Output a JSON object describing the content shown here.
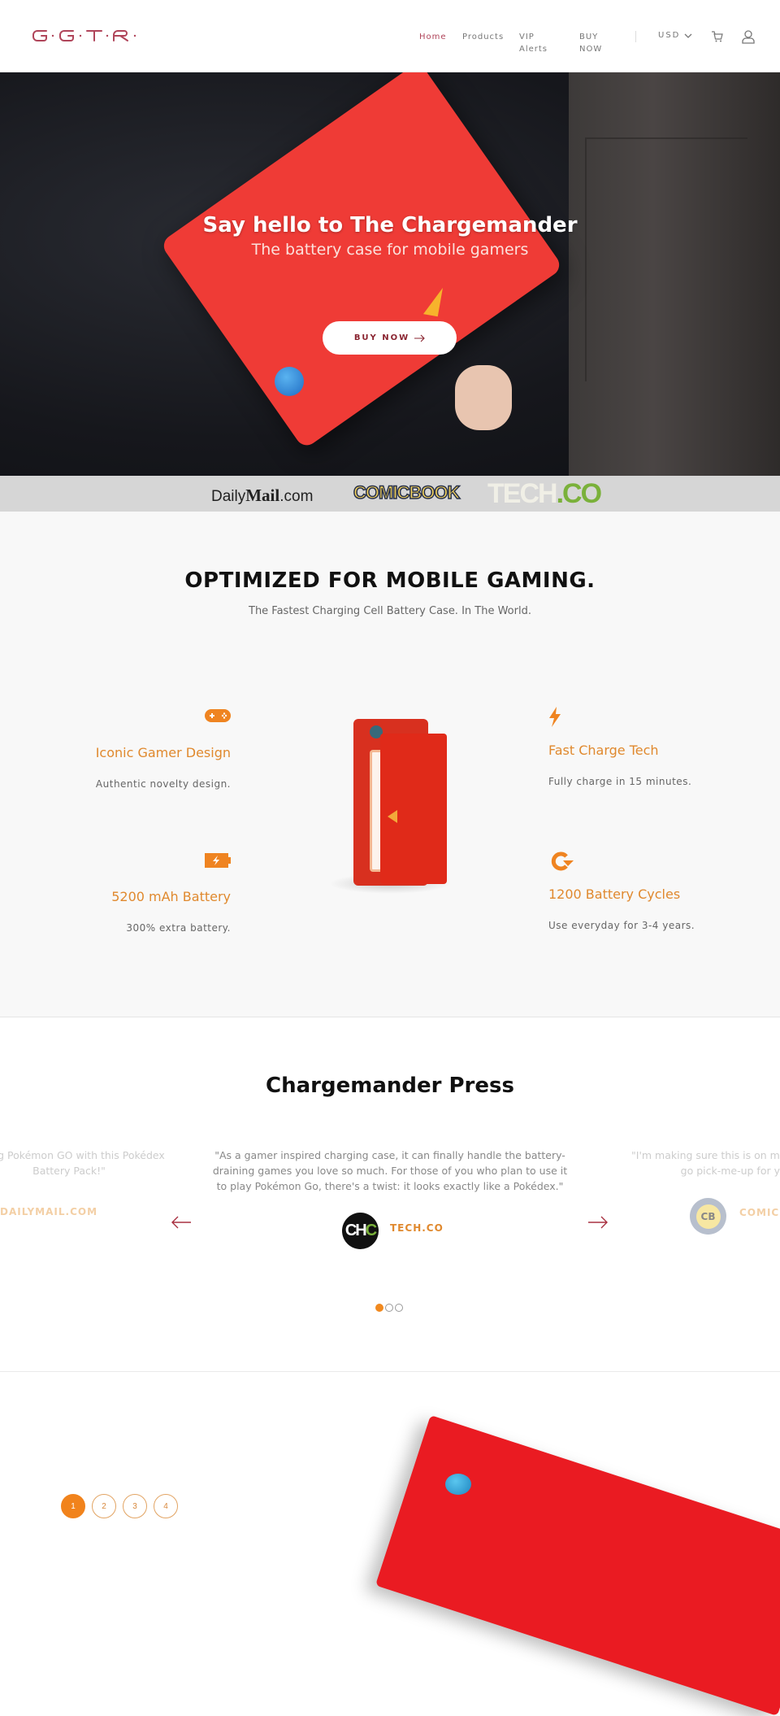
{
  "header": {
    "logo_text": "G·G·T·R·",
    "nav": [
      {
        "label": "Home",
        "active": true
      },
      {
        "label": "Products"
      },
      {
        "label": "VIP Alerts"
      },
      {
        "label": "BUY NOW"
      }
    ],
    "currency": "USD",
    "icons": {
      "currency_dropdown": "chevron-down-icon",
      "cart": "cart-icon",
      "account": "user-icon"
    },
    "brand_color": "#b0455a"
  },
  "hero": {
    "title": "Say hello to The Chargemander",
    "subtitle": "The battery case for mobile gamers",
    "button_label": "BUY NOW",
    "button_icon": "arrow-right-icon"
  },
  "press_logos": [
    {
      "name": "DailyMail.com",
      "part1": "Daily",
      "part2": "Mail",
      "part3": ".com"
    },
    {
      "name": "COMICBOOK.com",
      "text": "COMICBOOK"
    },
    {
      "name": "TECH.CO",
      "part1": "TECH",
      "part2": ".CO"
    }
  ],
  "features": {
    "title": "OPTIMIZED FOR MOBILE GAMING.",
    "subtitle": "The Fastest Charging Cell Battery Case. In The World.",
    "accent_color": "#e0892e",
    "items": [
      {
        "icon": "gamepad-icon",
        "title": "Iconic Gamer Design",
        "description": "Authentic novelty  design."
      },
      {
        "icon": "lightning-icon",
        "title": "Fast Charge Tech",
        "description": "Fully charge in 15 minutes."
      },
      {
        "icon": "battery-charging-icon",
        "title": "5200 mAh Battery",
        "description": "300% extra battery."
      },
      {
        "icon": "refresh-icon",
        "title": "1200 Battery Cycles",
        "description": "Use everyday for 3-4 years."
      }
    ]
  },
  "press": {
    "title": "Chargemander Press",
    "quotes": [
      {
        "line1": "laying Pokémon GO with this Pokédex",
        "line2": "Battery Pack!\"",
        "source": "DAILYMAIL.COM"
      },
      {
        "line1": "\"As a gamer inspired charging case, it can finally handle the battery-",
        "line2": "draining games you love so much. For those of you who plan to use it",
        "line3": "to play Pokémon Go, there's a twist: it looks exactly like a Pokédex.\"",
        "source": "TECH.CO",
        "badge": "CHC"
      },
      {
        "line1": "\"I'm making sure this is on me at all ti",
        "line2": "go pick-me-up for y",
        "source": "COMICB",
        "badge": "CB"
      }
    ],
    "prev_icon": "arrow-left-icon",
    "next_icon": "arrow-right-icon",
    "slides": 3,
    "active_slide": 1
  },
  "gallery": {
    "pages": [
      "1",
      "2",
      "3",
      "4"
    ],
    "active_page": "1"
  }
}
